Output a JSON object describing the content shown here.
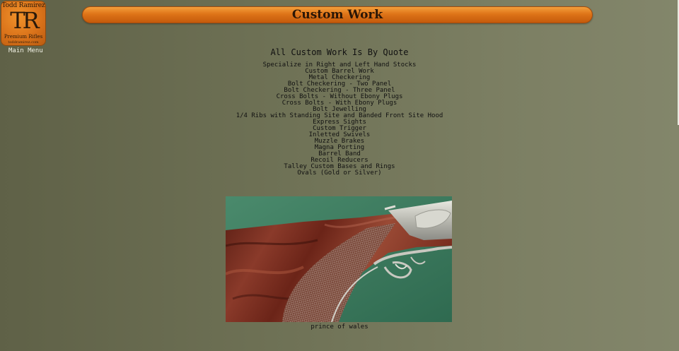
{
  "logo": {
    "name": "Todd Ramirez",
    "initials": "TR",
    "tagline": "Premium Rifles",
    "url": "toddramirez.com"
  },
  "nav": {
    "main_menu_label": "Main Menu"
  },
  "header": {
    "title": "Custom Work"
  },
  "content": {
    "heading": "All Custom Work Is By Quote",
    "services": [
      "Specialize in Right and Left Hand Stocks",
      "Custom Barrel Work",
      "Metal Checkering",
      "Bolt Checkering - Two Panel",
      "Bolt Checkering - Three Panel",
      "Cross Bolts - Without Ebony Plugs",
      "Cross Bolts - With Ebony Plugs",
      "Bolt Jewelling",
      "1/4 Ribs with Standing Site and Banded Front Site Hood",
      "Express Sights",
      "Custom Trigger",
      "Inletted Swivels",
      "Muzzle Brakes",
      "Magna Porting",
      "Barrel Band",
      "Recoil Reducers",
      "Talley Custom Bases and Rings",
      "Ovals (Gold or Silver)"
    ],
    "photo_caption": "prince of wales"
  },
  "colors": {
    "header_orange": "#de7418",
    "background_olive": "#6e7155",
    "photo_green": "#3f7d62"
  }
}
